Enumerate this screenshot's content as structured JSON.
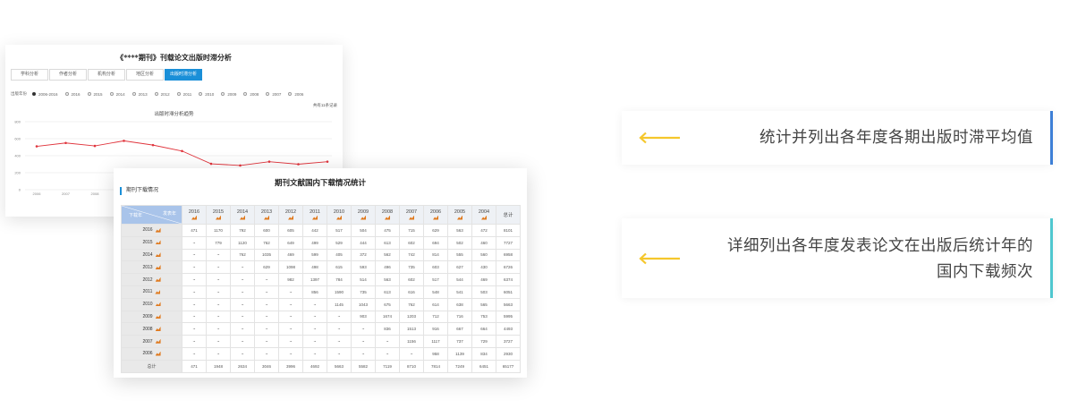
{
  "lag_panel": {
    "title": "《****期刊》刊载论文出版时滞分析",
    "tabs": [
      "学科分析",
      "作者分析",
      "机构分析",
      "地区分析",
      "出版时滞分析"
    ],
    "active_tab": 4,
    "year_label": "出版年份",
    "year_options": [
      "2006-2016",
      "2016",
      "2015",
      "2014",
      "2013",
      "2012",
      "2011",
      "2010",
      "2009",
      "2008",
      "2007",
      "2006"
    ],
    "selected_year": 0,
    "record_text": "共有11条记录",
    "chart_title": "出版时滞分析趋势",
    "line_color": "#e0343c"
  },
  "chart_data": {
    "type": "line",
    "title": "出版时滞分析趋势",
    "x": [
      "2006",
      "2007",
      "2008",
      "2009",
      "2010",
      "2011",
      "2012",
      "2013",
      "2014",
      "2015",
      "2016"
    ],
    "values": [
      510,
      550,
      515,
      575,
      525,
      455,
      305,
      285,
      330,
      300,
      330
    ],
    "yticks": [
      "800",
      "600",
      "400",
      "200",
      "0"
    ],
    "ylim": [
      0,
      800
    ]
  },
  "download_panel": {
    "title": "期刊文献国内下载情况统计",
    "section_label": "期刊下载情况",
    "corner_top": "发表年",
    "corner_bottom": "下载年",
    "years": [
      "2016",
      "2015",
      "2014",
      "2013",
      "2012",
      "2011",
      "2010",
      "2009",
      "2008",
      "2007",
      "2006",
      "2005",
      "2004"
    ],
    "total_col_label": "总计",
    "rows": [
      {
        "label": "2016",
        "cells": [
          "471",
          "1170",
          "792",
          "600",
          "605",
          "442",
          "517",
          "504",
          "475",
          "715",
          "629",
          "563",
          "472",
          "8101"
        ]
      },
      {
        "label": "2015",
        "cells": [
          "~",
          "779",
          "1120",
          "762",
          "649",
          "499",
          "529",
          "444",
          "613",
          "602",
          "694",
          "502",
          "460",
          "7727"
        ]
      },
      {
        "label": "2014",
        "cells": [
          "~",
          "~",
          "762",
          "1035",
          "469",
          "599",
          "405",
          "372",
          "562",
          "742",
          "814",
          "555",
          "560",
          "6958"
        ]
      },
      {
        "label": "2013",
        "cells": [
          "~",
          "~",
          "~",
          "629",
          "1098",
          "498",
          "615",
          "593",
          "496",
          "735",
          "603",
          "627",
          "430",
          "6726"
        ]
      },
      {
        "label": "2012",
        "cells": [
          "~",
          "~",
          "~",
          "~",
          "982",
          "1397",
          "784",
          "514",
          "563",
          "602",
          "517",
          "544",
          "469",
          "6374"
        ]
      },
      {
        "label": "2011",
        "cells": [
          "~",
          "~",
          "~",
          "~",
          "~",
          "856",
          "1590",
          "735",
          "613",
          "616",
          "548",
          "541",
          "503",
          "6051"
        ]
      },
      {
        "label": "2010",
        "cells": [
          "~",
          "~",
          "~",
          "~",
          "~",
          "~",
          "1145",
          "1043",
          "675",
          "762",
          "614",
          "638",
          "565",
          "5663"
        ]
      },
      {
        "label": "2009",
        "cells": [
          "~",
          "~",
          "~",
          "~",
          "~",
          "~",
          "~",
          "903",
          "1674",
          "1203",
          "712",
          "716",
          "753",
          "5995"
        ]
      },
      {
        "label": "2008",
        "cells": [
          "~",
          "~",
          "~",
          "~",
          "~",
          "~",
          "~",
          "~",
          "836",
          "1513",
          "916",
          "667",
          "664",
          "4493"
        ]
      },
      {
        "label": "2007",
        "cells": [
          "~",
          "~",
          "~",
          "~",
          "~",
          "~",
          "~",
          "~",
          "~",
          "1156",
          "1117",
          "737",
          "729",
          "3727"
        ]
      },
      {
        "label": "2006",
        "cells": [
          "~",
          "~",
          "~",
          "~",
          "~",
          "~",
          "~",
          "~",
          "~",
          "~",
          "958",
          "1139",
          "834",
          "2930"
        ]
      }
    ],
    "total_row": {
      "label": "总计",
      "cells": [
        "471",
        "1948",
        "2634",
        "3046",
        "3996",
        "4692",
        "5663",
        "5582",
        "7119",
        "8710",
        "7814",
        "7249",
        "6451",
        "65177"
      ]
    }
  },
  "notes": [
    {
      "text": "统计并列出各年度各期出版时滞平均值",
      "accent": "#3d7fd6"
    },
    {
      "line1": "详细列出各年度发表论文在出版后统计年的",
      "line2": "国内下载频次",
      "accent": "#4fc7cf"
    }
  ],
  "arrow_color": "#f5c72c"
}
